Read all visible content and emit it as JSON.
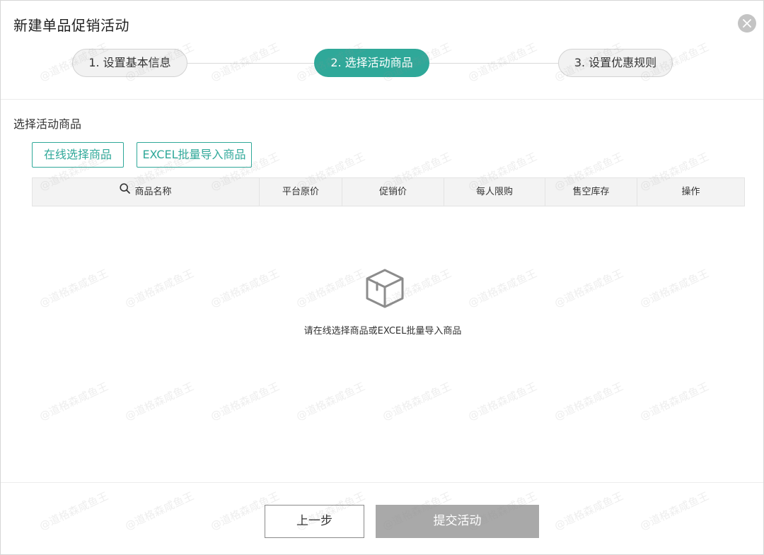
{
  "dialog": {
    "title": "新建单品促销活动",
    "close_icon": "close-icon"
  },
  "steps": [
    {
      "label": "1. 设置基本信息",
      "state": "inactive"
    },
    {
      "label": "2. 选择活动商品",
      "state": "active"
    },
    {
      "label": "3. 设置优惠规则",
      "state": "inactive"
    }
  ],
  "section": {
    "title": "选择活动商品",
    "online_select_label": "在线选择商品",
    "excel_import_label": "EXCEL批量导入商品"
  },
  "table": {
    "columns": [
      "商品名称",
      "平台原价",
      "促销价",
      "每人限购",
      "售空库存",
      "操作"
    ],
    "search_icon": "search-icon"
  },
  "empty_state": {
    "icon": "box-icon",
    "message": "请在线选择商品或EXCEL批量导入商品"
  },
  "footer": {
    "prev_label": "上一步",
    "submit_label": "提交活动"
  },
  "watermark": {
    "text": "@道格森咸鱼王"
  },
  "colors": {
    "accent": "#2fa899",
    "disabled": "#a9a9a9"
  }
}
